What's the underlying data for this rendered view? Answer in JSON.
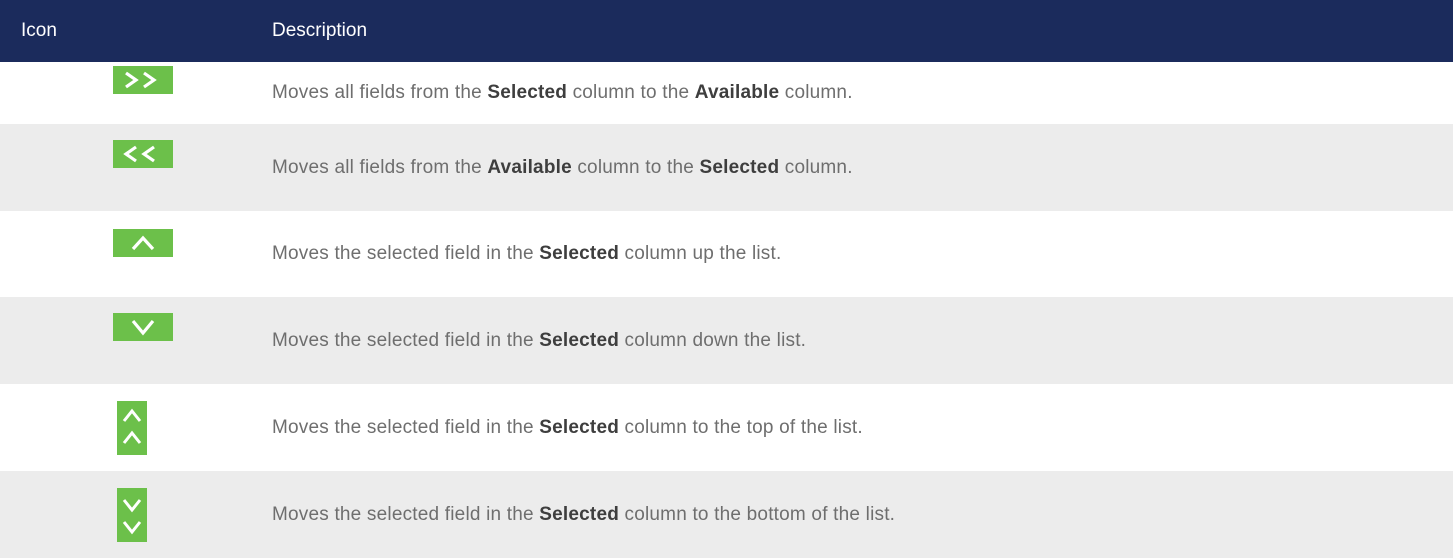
{
  "header": {
    "icon_label": "Icon",
    "description_label": "Description"
  },
  "rows": [
    {
      "icon": "move-all-right-icon",
      "parts": [
        "Moves all fields from the ",
        "Selected",
        " column to the ",
        "Available",
        " column."
      ]
    },
    {
      "icon": "move-all-left-icon",
      "parts": [
        "Moves all fields from the ",
        "Available",
        " column to the ",
        "Selected",
        " column."
      ]
    },
    {
      "icon": "move-up-icon",
      "parts": [
        "Moves the selected field in the ",
        "Selected",
        " column up the list."
      ]
    },
    {
      "icon": "move-down-icon",
      "parts": [
        "Moves the selected field in the ",
        "Selected",
        " column down the list."
      ]
    },
    {
      "icon": "move-to-top-icon",
      "parts": [
        "Moves the selected field in the ",
        "Selected",
        " column to the top of the list."
      ]
    },
    {
      "icon": "move-to-bottom-icon",
      "parts": [
        "Moves the selected field in the ",
        "Selected",
        " column to the bottom of the list."
      ]
    }
  ],
  "colors": {
    "header_bg": "#1b2b5c",
    "icon_bg": "#6cc04a",
    "row_shade": "#ececec",
    "text": "#6e6e6e"
  }
}
